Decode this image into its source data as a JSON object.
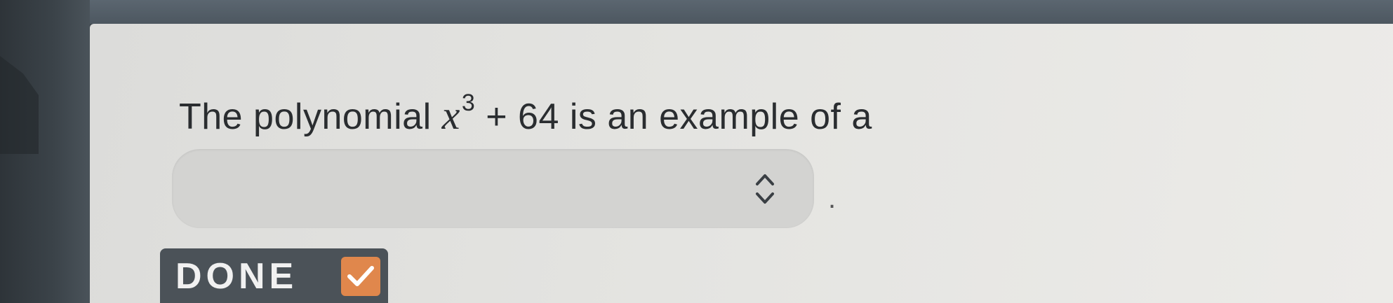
{
  "question": {
    "prefix": "The polynomial",
    "variable": "x",
    "exponent": "3",
    "rest": "+ 64",
    "suffix": "is an example of a"
  },
  "dropdown": {
    "selected_value": "",
    "icon": "chevron-up-down-icon"
  },
  "period": ".",
  "done_button": {
    "label": "DONE",
    "icon": "checkmark-icon",
    "accent_color": "#e0874c"
  }
}
